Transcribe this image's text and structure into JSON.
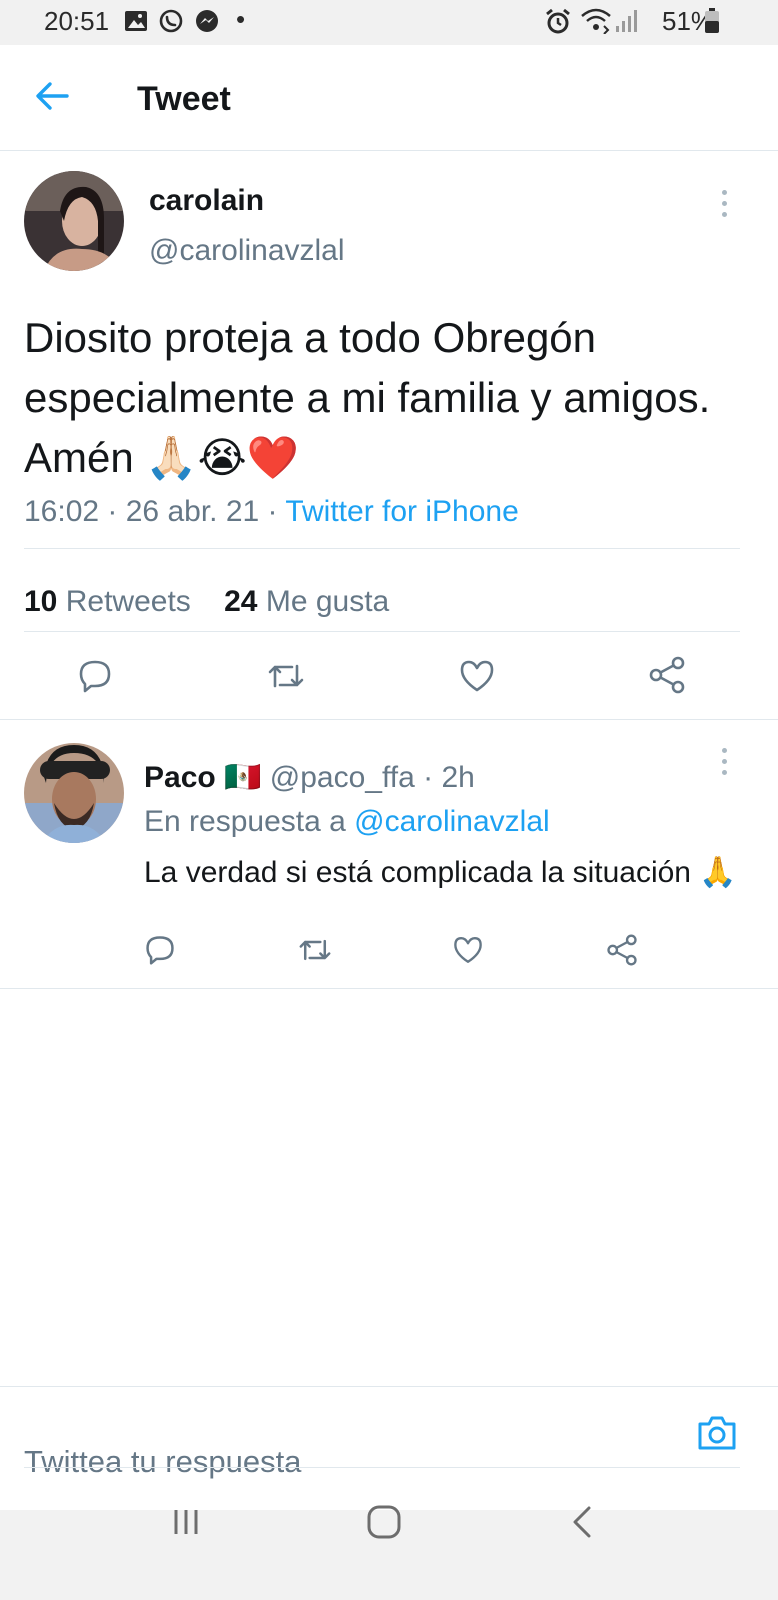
{
  "status_bar": {
    "time": "20:51",
    "battery": "51%"
  },
  "header": {
    "title": "Tweet"
  },
  "tweet": {
    "display_name": "carolain",
    "handle": "@carolinavzlal",
    "text": "Diosito proteja a todo Obregón especialmente a mi familia y amigos. Amén 🙏🏻😭❤️",
    "time": "16:02",
    "date": "26 abr. 21",
    "source": "Twitter for iPhone",
    "retweets_count": "10",
    "retweets_label": "Retweets",
    "likes_count": "24",
    "likes_label": "Me gusta"
  },
  "reply": {
    "display_name": "Paco",
    "flag": "🇲🇽",
    "handle": "@paco_ffa",
    "age": "2h",
    "in_reply_prefix": "En respuesta a",
    "in_reply_handle": "@carolinavzlal",
    "text": "La verdad si está complicada la situación 🙏"
  },
  "compose": {
    "placeholder": "Twittea tu respuesta"
  },
  "colors": {
    "accent": "#1da1f2",
    "secondary_text": "#657786",
    "heart": "#d50b2c"
  },
  "icons": [
    "back-arrow-icon",
    "more-icon",
    "reply-icon",
    "retweet-icon",
    "like-icon",
    "share-icon",
    "camera-icon"
  ]
}
